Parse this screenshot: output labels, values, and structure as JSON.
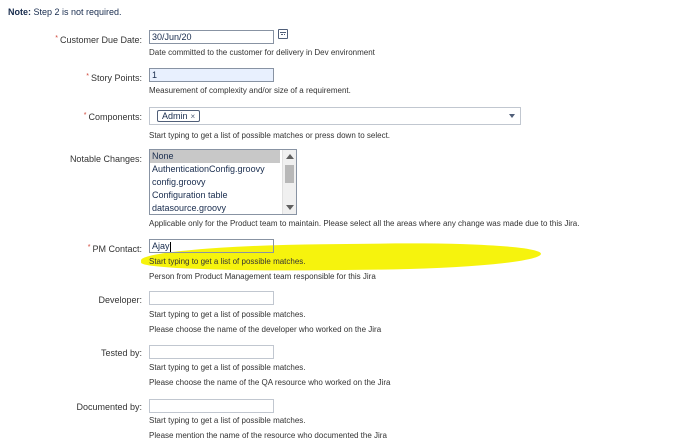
{
  "note": {
    "prefix": "Note:",
    "text": " Step 2 is not required."
  },
  "fields": {
    "customer_due_date": {
      "label": "Customer Due Date:",
      "value": "30/Jun/20",
      "description": "Date committed to the customer for delivery in Dev environment",
      "required_mark": "*"
    },
    "story_points": {
      "label": "Story Points:",
      "value": "1",
      "description": "Measurement of complexity and/or size of a requirement.",
      "required_mark": "*"
    },
    "components": {
      "label": "Components:",
      "chip": "Admin",
      "chip_remove": "×",
      "description": "Start typing to get a list of possible matches or press down to select.",
      "required_mark": "*"
    },
    "notable_changes": {
      "label": "Notable Changes:",
      "options": [
        "None",
        "AuthenticationConfig.groovy",
        "config.groovy",
        "Configuration table",
        "datasource.groovy"
      ],
      "selected": "None",
      "description": "Applicable only for the Product team to maintain. Please select all the areas where any change was made due to this Jira."
    },
    "pm_contact": {
      "label": "PM Contact:",
      "value": "Ajay",
      "hint": "Start typing to get a list of possible matches.",
      "description": "Person from Product Management team responsible for this Jira",
      "required_mark": "*"
    },
    "developer": {
      "label": "Developer:",
      "value": "",
      "hint": "Start typing to get a list of possible matches.",
      "description": "Please choose the name of the developer who worked on the Jira"
    },
    "tested_by": {
      "label": "Tested by:",
      "value": "",
      "hint": "Start typing to get a list of possible matches.",
      "description": "Please choose the name of the QA resource who worked on the Jira"
    },
    "documented_by": {
      "label": "Documented by:",
      "value": "",
      "hint": "Start typing to get a list of possible matches.",
      "description": "Please mention the name of the resource who documented the Jira"
    }
  },
  "icons": {
    "calendar": "calendar-icon",
    "dropdown": "chevron-down-icon"
  },
  "colors": {
    "highlight": "#f6f200",
    "required": "#d04437"
  }
}
